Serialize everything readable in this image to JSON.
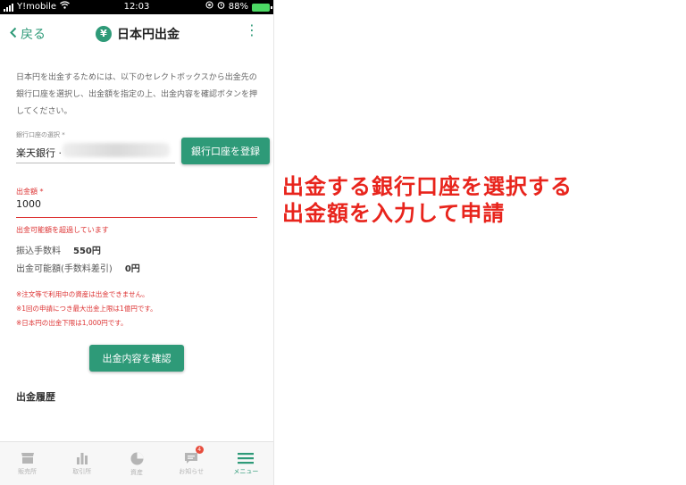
{
  "status_bar": {
    "carrier": "Y!mobile",
    "time": "12:03",
    "battery": "88%"
  },
  "header": {
    "back_label": "戻る",
    "currency_symbol": "¥",
    "title": "日本円出金"
  },
  "description": "日本円を出金するためには、以下のセレクトボックスから出金先の銀行口座を選択し、出金額を指定の上、出金内容を確認ボタンを押してください。",
  "bank": {
    "label": "銀行口座の選択 *",
    "value": "楽天銀行 ·",
    "register_button": "銀行口座を登録"
  },
  "amount": {
    "label": "出金額 *",
    "value": "1000",
    "error": "出金可能額を超過しています"
  },
  "fees": [
    {
      "label": "振込手数料",
      "value": "550円"
    },
    {
      "label": "出金可能額(手数料差引)",
      "value": "0円"
    }
  ],
  "notes": [
    "※注文等で利用中の資産は出金できません。",
    "※1回の申請につき最大出金上限は1億円です。",
    "※日本円の出金下限は1,000円です。"
  ],
  "confirm_button": "出金内容を確認",
  "history_title": "出金履歴",
  "tabbar": {
    "items": [
      {
        "label": "販売所"
      },
      {
        "label": "取引所"
      },
      {
        "label": "資産"
      },
      {
        "label": "お知らせ",
        "badge": "4"
      },
      {
        "label": "メニュー"
      }
    ]
  },
  "annotation": {
    "line1": "出金する銀行口座を選択する",
    "line2": "出金額を入力して申請"
  },
  "colors": {
    "accent": "#2e9a78",
    "error": "#d33333",
    "annotation": "#e8241c"
  }
}
